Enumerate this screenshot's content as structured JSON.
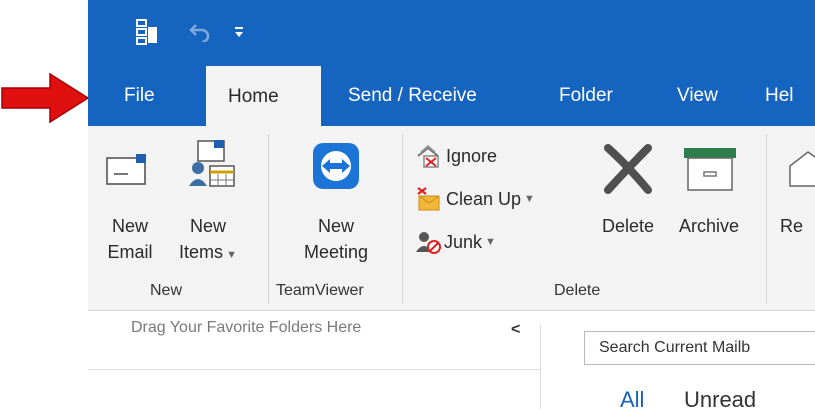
{
  "quick_access": {
    "app_icon": "outlook-qat-icon",
    "undo_icon": "undo-icon",
    "customize_icon": "qat-customize-icon"
  },
  "tabs": [
    {
      "label": "File"
    },
    {
      "label": "Home"
    },
    {
      "label": "Send / Receive"
    },
    {
      "label": "Folder"
    },
    {
      "label": "View"
    },
    {
      "label": "Hel"
    }
  ],
  "ribbon": {
    "new_group": {
      "new_email": {
        "line1": "New",
        "line2": "Email"
      },
      "new_items": {
        "line1": "New",
        "line2": "Items"
      },
      "label": "New"
    },
    "teamviewer_group": {
      "new_meeting": {
        "line1": "New",
        "line2": "Meeting"
      },
      "label": "TeamViewer"
    },
    "delete_group": {
      "ignore": "Ignore",
      "cleanup": "Clean Up",
      "junk": "Junk",
      "delete": "Delete",
      "archive": "Archive",
      "label": "Delete"
    },
    "respond_partial": "Re"
  },
  "folder_pane": {
    "hint": "Drag Your Favorite Folders Here",
    "collapse_glyph": "<"
  },
  "mail_list": {
    "search_placeholder": "Search Current Mailb",
    "filter_all": "All",
    "filter_unread": "Unread"
  },
  "colors": {
    "accent": "#1565c0",
    "arrow": "#e01010",
    "ribbon_bg": "#f3f3f3"
  }
}
